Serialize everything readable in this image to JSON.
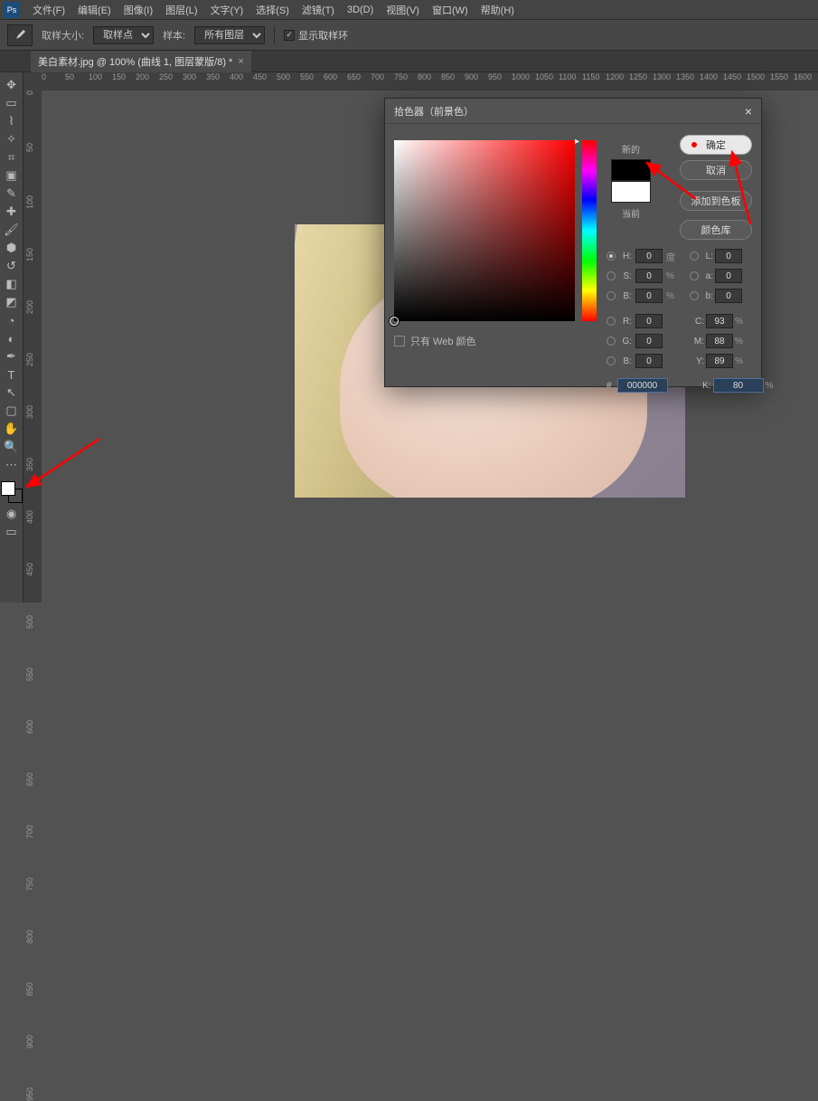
{
  "menu": {
    "items": [
      "文件(F)",
      "编辑(E)",
      "图像(I)",
      "图层(L)",
      "文字(Y)",
      "选择(S)",
      "滤镜(T)",
      "3D(D)",
      "视图(V)",
      "窗口(W)",
      "帮助(H)"
    ]
  },
  "options": {
    "sample_size_label": "取样大小:",
    "sample_size_value": "取样点",
    "sample_label": "样本:",
    "sample_value": "所有图层",
    "show_ring": "显示取样环"
  },
  "tab": {
    "title": "美白素材.jpg @ 100% (曲线 1, 图层蒙版/8) *"
  },
  "ruler_h": [
    0,
    50,
    100,
    150,
    200,
    250,
    300,
    350,
    400,
    450,
    500,
    550,
    600,
    650,
    700,
    750,
    800,
    850,
    900,
    950,
    1000,
    1050,
    1100,
    1150,
    1200,
    1250,
    1300,
    1350,
    1400,
    1450,
    1500,
    1550,
    1600
  ],
  "ruler_v": [
    0,
    50,
    100,
    150,
    200,
    250,
    300,
    350,
    400,
    450,
    500,
    550,
    600,
    650,
    700,
    750,
    800,
    850,
    900,
    950
  ],
  "dialog": {
    "title": "拾色器（前景色）",
    "new_label": "新的",
    "current_label": "当前",
    "ok": "确定",
    "cancel": "取消",
    "add_swatch": "添加到色板",
    "color_lib": "颜色库",
    "web_only": "只有 Web 颜色",
    "fields": {
      "H": {
        "label": "H:",
        "value": "0",
        "unit": "度"
      },
      "S": {
        "label": "S:",
        "value": "0",
        "unit": "%"
      },
      "B": {
        "label": "B:",
        "value": "0",
        "unit": "%"
      },
      "L": {
        "label": "L:",
        "value": "0",
        "unit": ""
      },
      "a": {
        "label": "a:",
        "value": "0",
        "unit": ""
      },
      "b": {
        "label": "b:",
        "value": "0",
        "unit": ""
      },
      "R": {
        "label": "R:",
        "value": "0",
        "unit": ""
      },
      "G": {
        "label": "G:",
        "value": "0",
        "unit": ""
      },
      "Bc": {
        "label": "B:",
        "value": "0",
        "unit": ""
      },
      "C": {
        "label": "C:",
        "value": "93",
        "unit": "%"
      },
      "M": {
        "label": "M:",
        "value": "88",
        "unit": "%"
      },
      "Y": {
        "label": "Y:",
        "value": "89",
        "unit": "%"
      },
      "K": {
        "label": "K:",
        "value": "80",
        "unit": "%"
      },
      "hex_label": "#",
      "hex": "000000"
    }
  }
}
